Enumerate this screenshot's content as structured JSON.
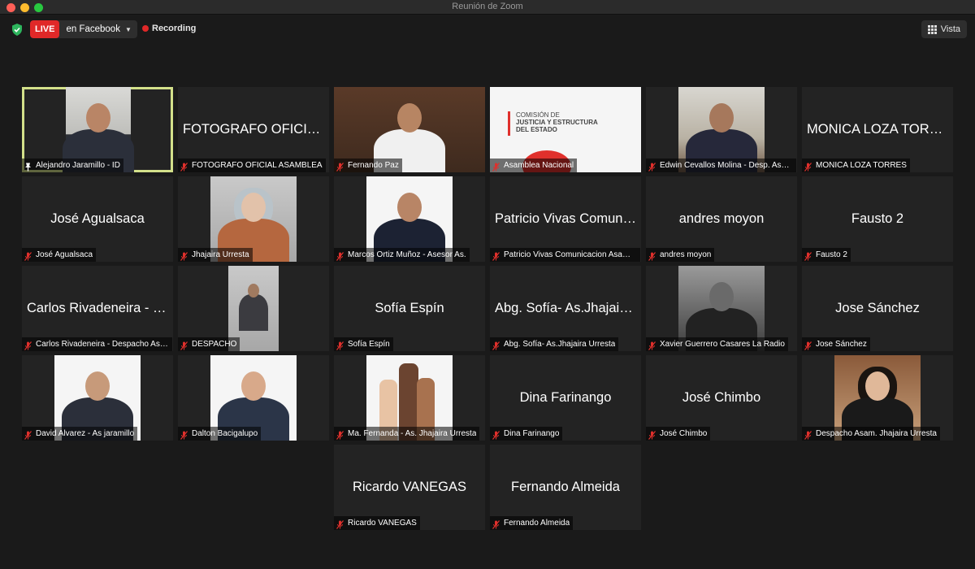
{
  "window": {
    "title": "Reunión de Zoom"
  },
  "toolbar": {
    "live_badge": "LIVE",
    "live_target": "en Facebook",
    "recording_label": "Recording",
    "view_label": "Vista"
  },
  "participants": [
    {
      "display": "",
      "label": "Alejandro Jaramillo - ID",
      "video": true,
      "pinned": true
    },
    {
      "display": "FOTOGRAFO OFICIAL ASAMBLEA",
      "label": "FOTOGRAFO OFICIAL ASAMBLEA",
      "video": false
    },
    {
      "display": "",
      "label": "Fernando Paz",
      "video": true
    },
    {
      "display": "",
      "label": "Asamblea Nacional",
      "video": true
    },
    {
      "display": "",
      "label": "Edwin Cevallos Molina - Desp. Asambleísta",
      "video": true
    },
    {
      "display": "MONICA LOZA TORRES",
      "label": "MONICA LOZA TORRES",
      "video": false
    },
    {
      "display": "José Agualsaca",
      "label": "José Agualsaca",
      "video": false
    },
    {
      "display": "",
      "label": "Jhajaira Urresta",
      "video": true
    },
    {
      "display": "",
      "label": "Marcos Ortiz Muñoz - Asesor As.",
      "video": true
    },
    {
      "display": "Patricio Vivas Comunicacion",
      "label": "Patricio Vivas Comunicacion Asamblea",
      "video": false
    },
    {
      "display": "andres moyon",
      "label": "andres moyon",
      "video": false
    },
    {
      "display": "Fausto 2",
      "label": "Fausto 2",
      "video": false
    },
    {
      "display": "Carlos Rivadeneira - Despacho",
      "label": "Carlos Rivadeneira - Despacho Asambleísta",
      "video": false
    },
    {
      "display": "",
      "label": "DESPACHO",
      "video": true
    },
    {
      "display": "Sofía Espín",
      "label": "Sofía Espín",
      "video": false
    },
    {
      "display": "Abg. Sofía- As.Jhajaira Urresta",
      "label": "Abg. Sofía- As.Jhajaira Urresta",
      "video": false
    },
    {
      "display": "",
      "label": "Xavier Guerrero Casares La Radio",
      "video": true
    },
    {
      "display": "Jose Sánchez",
      "label": "Jose Sánchez",
      "video": false
    },
    {
      "display": "",
      "label": "David Alvarez - As jaramillo",
      "video": true
    },
    {
      "display": "",
      "label": "Dalton Bacigalupo",
      "video": true
    },
    {
      "display": "",
      "label": "Ma. Fernanda - As. Jhajaira Urresta",
      "video": true
    },
    {
      "display": "Dina Farinango",
      "label": "Dina Farinango",
      "video": false
    },
    {
      "display": "José Chimbo",
      "label": "José Chimbo",
      "video": false
    },
    {
      "display": "",
      "label": "Despacho Asam. Jhajaira Urresta",
      "video": true
    },
    {
      "display": "Ricardo VANEGAS",
      "label": "Ricardo VANEGAS",
      "video": false
    },
    {
      "display": "Fernando Almeida",
      "label": "Fernando Almeida",
      "video": false
    }
  ],
  "slide": {
    "line1": "COMISIÓN DE",
    "line2": "JUSTICIA Y ESTRUCTURA",
    "line3": "DEL ESTADO"
  },
  "colors": {
    "live": "#e02828",
    "active_speaker": "#d3e08a",
    "muted_icon": "#e0302c"
  }
}
